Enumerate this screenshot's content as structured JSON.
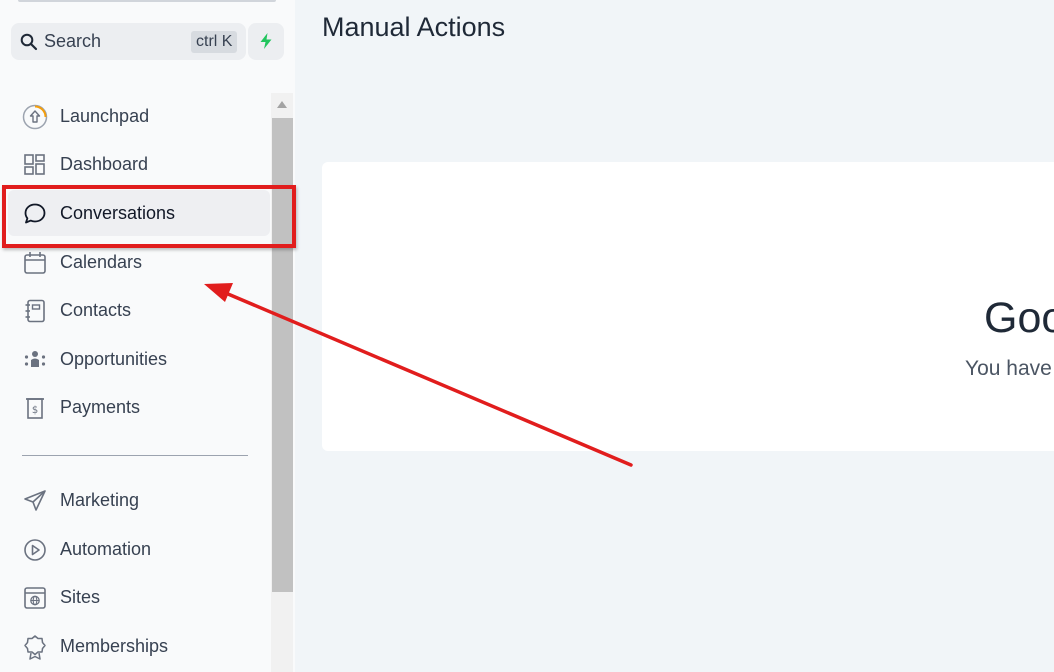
{
  "sidebar": {
    "search": {
      "label": "Search",
      "shortcut": "ctrl K"
    },
    "nav_primary": [
      {
        "label": "Launchpad",
        "icon": "launchpad-icon",
        "active": false
      },
      {
        "label": "Dashboard",
        "icon": "dashboard-icon",
        "active": false
      },
      {
        "label": "Conversations",
        "icon": "chat-bubble-icon",
        "active": true
      },
      {
        "label": "Calendars",
        "icon": "calendar-icon",
        "active": false
      },
      {
        "label": "Contacts",
        "icon": "contacts-book-icon",
        "active": false
      },
      {
        "label": "Opportunities",
        "icon": "opportunities-icon",
        "active": false
      },
      {
        "label": "Payments",
        "icon": "payments-icon",
        "active": false
      }
    ],
    "nav_secondary": [
      {
        "label": "Marketing",
        "icon": "paper-plane-icon"
      },
      {
        "label": "Automation",
        "icon": "automation-icon"
      },
      {
        "label": "Sites",
        "icon": "globe-window-icon"
      },
      {
        "label": "Memberships",
        "icon": "badge-icon"
      }
    ]
  },
  "main": {
    "title": "Manual Actions",
    "card": {
      "heading": "Goo",
      "subtext": "You have"
    }
  },
  "annotation": {
    "color": "#e11d1d"
  },
  "colors": {
    "accent_green": "#22c55e",
    "background": "#f1f5f8"
  }
}
